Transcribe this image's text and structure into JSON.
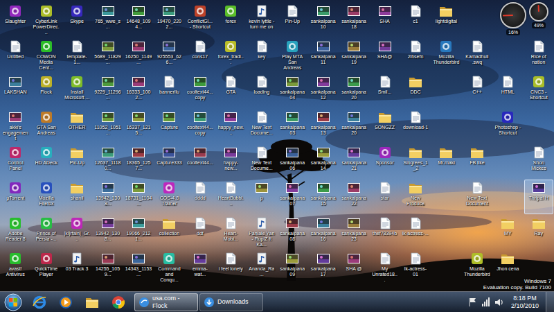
{
  "desktop": {
    "columns": [
      [
        {
          "label": "Slaughter",
          "kind": "app",
          "selected": false
        },
        {
          "label": "Untitled",
          "kind": "doc",
          "selected": false
        },
        {
          "label": "LAKSHAN",
          "kind": "photo",
          "selected": false
        },
        {
          "label": "akki's engagement",
          "kind": "photo",
          "selected": false
        },
        {
          "label": "Control Panel",
          "kind": "app",
          "selected": false
        },
        {
          "label": "µTorrent",
          "kind": "app",
          "selected": false
        },
        {
          "label": "Adobe Reader 8",
          "kind": "app",
          "selected": false
        },
        {
          "label": "avast! Antivirus",
          "kind": "app",
          "selected": false
        }
      ],
      [
        {
          "label": "CyberLink PowerDirec...",
          "kind": "app",
          "selected": false
        },
        {
          "label": "COWON Media Cent...",
          "kind": "app",
          "selected": false
        },
        {
          "label": "Flock",
          "kind": "app",
          "selected": false
        },
        {
          "label": "GTA San Andreas",
          "kind": "app",
          "selected": false
        },
        {
          "label": "HD ADeck",
          "kind": "app",
          "selected": false
        },
        {
          "label": "Mozilla Firefox",
          "kind": "app",
          "selected": false
        },
        {
          "label": "Prince of Persia -...",
          "kind": "app",
          "selected": false
        },
        {
          "label": "QuickTime Player",
          "kind": "app",
          "selected": false
        }
      ],
      [
        {
          "label": "Skype",
          "kind": "app",
          "selected": false
        },
        {
          "label": "template-1...",
          "kind": "doc",
          "selected": false
        },
        {
          "label": "Install Microsoft ...",
          "kind": "app",
          "selected": false
        },
        {
          "label": "OTHER",
          "kind": "folder",
          "selected": false
        },
        {
          "label": "Pin-Up",
          "kind": "folder",
          "selected": false
        },
        {
          "label": "shanil",
          "kind": "folder",
          "selected": false
        },
        {
          "label": "[kl]rfain]_Gr...",
          "kind": "app",
          "selected": false
        },
        {
          "label": "03 Track 3",
          "kind": "audio",
          "selected": false
        }
      ],
      [
        {
          "label": "765_wwe_s...",
          "kind": "photo",
          "selected": false
        },
        {
          "label": "5689_11829...",
          "kind": "photo",
          "selected": false
        },
        {
          "label": "9229_11296...",
          "kind": "photo",
          "selected": false
        },
        {
          "label": "11052_1051...",
          "kind": "photo",
          "selected": false
        },
        {
          "label": "12637_11180...",
          "kind": "photo",
          "selected": false
        },
        {
          "label": "13942_1308...",
          "kind": "photo",
          "selected": false
        },
        {
          "label": "13942_1308...",
          "kind": "photo",
          "selected": false
        },
        {
          "label": "14255_1059...",
          "kind": "photo",
          "selected": false
        }
      ],
      [
        {
          "label": "14648_1094...",
          "kind": "photo",
          "selected": false
        },
        {
          "label": "16250_1149...",
          "kind": "photo",
          "selected": false
        },
        {
          "label": "16333_1002...",
          "kind": "photo",
          "selected": false
        },
        {
          "label": "16337_1215...",
          "kind": "photo",
          "selected": false
        },
        {
          "label": "18365_1257...",
          "kind": "photo",
          "selected": false
        },
        {
          "label": "18731_1104...",
          "kind": "photo",
          "selected": false
        },
        {
          "label": "19066_2121...",
          "kind": "photo",
          "selected": false
        },
        {
          "label": "14343_1153...",
          "kind": "photo",
          "selected": false
        }
      ],
      [
        {
          "label": "19470_2202...",
          "kind": "photo",
          "selected": false
        },
        {
          "label": "925553_626...",
          "kind": "photo",
          "selected": false
        },
        {
          "label": "bannerllu",
          "kind": "doc",
          "selected": false
        },
        {
          "label": "Capture",
          "kind": "photo",
          "selected": false
        },
        {
          "label": "Capture333",
          "kind": "photo",
          "selected": false
        },
        {
          "label": "COS-4.8 Trainer",
          "kind": "app",
          "selected": false
        },
        {
          "label": "collection",
          "kind": "folder",
          "selected": false
        },
        {
          "label": "Command and Conqu...",
          "kind": "app",
          "selected": false
        }
      ],
      [
        {
          "label": "ConflictGl... - Shortcut",
          "kind": "app",
          "selected": false
        },
        {
          "label": "cons17",
          "kind": "doc",
          "selected": false
        },
        {
          "label": "cooltext44... copy",
          "kind": "photo",
          "selected": false
        },
        {
          "label": "cooltext44... copy",
          "kind": "photo",
          "selected": false
        },
        {
          "label": "cooltext44...",
          "kind": "photo",
          "selected": false
        },
        {
          "label": "dddd",
          "kind": "doc",
          "selected": false
        },
        {
          "label": "ddf",
          "kind": "doc",
          "selected": false
        },
        {
          "label": "emma-wat...",
          "kind": "photo",
          "selected": false
        }
      ],
      [
        {
          "label": "forex",
          "kind": "app",
          "selected": false
        },
        {
          "label": "forex_tradi...",
          "kind": "app",
          "selected": false
        },
        {
          "label": "GTA",
          "kind": "doc",
          "selected": false
        },
        {
          "label": "happy_new...",
          "kind": "photo",
          "selected": false
        },
        {
          "label": "happy-new...",
          "kind": "photo",
          "selected": false
        },
        {
          "label": "HeartBubbl...",
          "kind": "doc",
          "selected": false
        },
        {
          "label": "Heart-Mobi...",
          "kind": "doc",
          "selected": false
        },
        {
          "label": "i feel lonely",
          "kind": "doc",
          "selected": false
        }
      ],
      [
        {
          "label": "kevin lyttle - turn me on",
          "kind": "audio",
          "selected": false
        },
        {
          "label": "key",
          "kind": "doc",
          "selected": false
        },
        {
          "label": "loading",
          "kind": "doc",
          "selected": false
        },
        {
          "label": "New Text Docume...",
          "kind": "doc",
          "selected": false
        },
        {
          "label": "New Text Docume...",
          "kind": "doc",
          "selected": false
        },
        {
          "label": "p",
          "kind": "photo",
          "selected": false
        },
        {
          "label": "Panlale Yan - RupiZ ft Ka...",
          "kind": "audio",
          "selected": false
        },
        {
          "label": "Ananda_Ra...",
          "kind": "audio",
          "selected": false
        }
      ],
      [
        {
          "label": "Pin-Up",
          "kind": "doc",
          "selected": false
        },
        {
          "label": "Play MTA San Andreas",
          "kind": "app",
          "selected": false
        },
        {
          "label": "sankalpana 04",
          "kind": "photo",
          "selected": false
        },
        {
          "label": "sankalpana 03",
          "kind": "photo",
          "selected": false
        },
        {
          "label": "sankalpana 06",
          "kind": "photo",
          "selected": false
        },
        {
          "label": "sankalpana 07",
          "kind": "photo",
          "selected": false
        },
        {
          "label": "sankalpana 08",
          "kind": "photo",
          "selected": false
        },
        {
          "label": "sankalpana 09",
          "kind": "photo",
          "selected": false
        }
      ],
      [
        {
          "label": "sankalpana 10",
          "kind": "photo",
          "selected": false
        },
        {
          "label": "sankalpana 11",
          "kind": "photo",
          "selected": false
        },
        {
          "label": "sankalpana 12",
          "kind": "photo",
          "selected": false
        },
        {
          "label": "sankalpana 13",
          "kind": "photo",
          "selected": false
        },
        {
          "label": "sankalpana 14",
          "kind": "photo",
          "selected": false
        },
        {
          "label": "sankalpana 15",
          "kind": "photo",
          "selected": false
        },
        {
          "label": "sankalpana 16",
          "kind": "photo",
          "selected": false
        },
        {
          "label": "sankalpana 17",
          "kind": "photo",
          "selected": false
        }
      ],
      [
        {
          "label": "sankalpana 18",
          "kind": "photo",
          "selected": false
        },
        {
          "label": "sankalpana 19",
          "kind": "photo",
          "selected": false
        },
        {
          "label": "sankalpana 20",
          "kind": "photo",
          "selected": false
        },
        {
          "label": "sankalpana 20",
          "kind": "photo",
          "selected": false
        },
        {
          "label": "sankalpana 21",
          "kind": "photo",
          "selected": false
        },
        {
          "label": "sankalpana 22",
          "kind": "photo",
          "selected": false
        },
        {
          "label": "sankalpana 23",
          "kind": "photo",
          "selected": false
        },
        {
          "label": "SHA @",
          "kind": "photo",
          "selected": false
        }
      ],
      [
        {
          "label": "SHA",
          "kind": "photo",
          "selected": false
        },
        {
          "label": "SHA@",
          "kind": "photo",
          "selected": false
        },
        {
          "label": "Smil...",
          "kind": "doc",
          "selected": false
        },
        {
          "label": "SONGZZ",
          "kind": "folder",
          "selected": false
        },
        {
          "label": "Sponsor",
          "kind": "app",
          "selected": false
        },
        {
          "label": "star",
          "kind": "doc",
          "selected": false
        },
        {
          "label": "thef78394b",
          "kind": "doc",
          "selected": false
        },
        {
          "label": "My Unrated18...",
          "kind": "doc",
          "selected": false
        }
      ],
      [
        {
          "label": "c1",
          "kind": "doc",
          "selected": false
        },
        {
          "label": "2ihsefn",
          "kind": "doc",
          "selected": false
        },
        {
          "label": "DDC",
          "kind": "folder",
          "selected": false
        },
        {
          "label": "download-1",
          "kind": "doc",
          "selected": false
        },
        {
          "label": "Singrees_1_2",
          "kind": "folder",
          "selected": false
        },
        {
          "label": "New Produce",
          "kind": "folder",
          "selected": false
        },
        {
          "label": "lk-actress-...",
          "kind": "doc",
          "selected": false
        },
        {
          "label": "lk-actress-01",
          "kind": "doc",
          "selected": false
        }
      ],
      [
        {
          "label": "lightdigital",
          "kind": "folder",
          "selected": false
        },
        {
          "label": "Mozilla Thunderbird",
          "kind": "app",
          "selected": false
        },
        {
          "kind": "empty"
        },
        {
          "kind": "empty"
        },
        {
          "label": "Mr.maki",
          "kind": "folder",
          "selected": false
        },
        {
          "kind": "empty"
        },
        {
          "kind": "empty"
        },
        {
          "kind": "empty"
        }
      ],
      [
        {
          "kind": "empty"
        },
        {
          "label": "Kamadhuli .swq",
          "kind": "doc",
          "selected": false
        },
        {
          "label": "C++",
          "kind": "doc",
          "selected": false
        },
        {
          "kind": "empty"
        },
        {
          "label": "FB like",
          "kind": "folder",
          "selected": false
        },
        {
          "label": "New Text Document",
          "kind": "doc",
          "selected": false
        },
        {
          "kind": "empty"
        },
        {
          "label": "Mozilla Thunderbird",
          "kind": "app",
          "selected": false
        }
      ],
      [
        {
          "kind": "empty"
        },
        {
          "kind": "empty"
        },
        {
          "label": "HTML",
          "kind": "doc",
          "selected": false
        },
        {
          "label": "Photoshop - Shortcut",
          "kind": "app",
          "selected": false
        },
        {
          "kind": "empty"
        },
        {
          "kind": "empty"
        },
        {
          "label": "MY",
          "kind": "folder",
          "selected": false
        },
        {
          "label": "Jhon cena",
          "kind": "folder",
          "selected": false
        }
      ],
      [
        {
          "kind": "empty"
        },
        {
          "label": "Rice of nation",
          "kind": "doc",
          "selected": false
        },
        {
          "label": "CNC3 - Shortcut",
          "kind": "app",
          "selected": false
        },
        {
          "kind": "empty"
        },
        {
          "label": "Shon Mickes",
          "kind": "doc",
          "selected": false
        },
        {
          "label": "Thripal H",
          "kind": "photo",
          "selected": true
        },
        {
          "label": "Ray",
          "kind": "folder",
          "selected": false
        },
        {
          "kind": "empty"
        }
      ]
    ]
  },
  "gadget": {
    "meters": [
      {
        "kind": "cpu",
        "level": 0.16,
        "reading": "16%"
      },
      {
        "kind": "memory",
        "level": 0.49,
        "reading": "49%"
      }
    ]
  },
  "watermark": [
    "Windows 7",
    "Evaluation copy. Build 7100"
  ],
  "taskbar": {
    "pinned": [
      {
        "kind": "ie"
      },
      {
        "kind": "wmp"
      },
      {
        "kind": "explorer"
      },
      {
        "kind": "chrome"
      }
    ],
    "tasks": [
      {
        "label": "usa.com - Flock",
        "kind": "flock",
        "selected": true
      },
      {
        "label": "Downloads",
        "kind": "downloads",
        "selected": false
      }
    ],
    "tray": [
      {
        "kind": "flag"
      },
      {
        "kind": "network"
      },
      {
        "kind": "volume"
      }
    ],
    "clock": {
      "time": "8:18 PM",
      "date": "2/10/2010"
    }
  }
}
